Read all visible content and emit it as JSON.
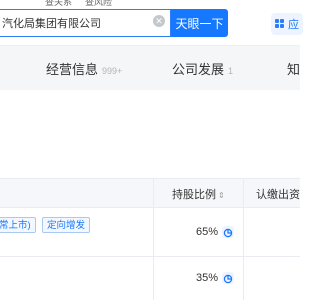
{
  "nav": {
    "links": [
      "查关系",
      "查风险"
    ]
  },
  "search": {
    "value": "汽化局集团有限公司",
    "button_label": "天眼一下"
  },
  "side_button": {
    "label": "应"
  },
  "tabs": [
    {
      "label": "经营信息",
      "count": "999+"
    },
    {
      "label": "公司发展",
      "count": "1"
    },
    {
      "label": "知"
    }
  ],
  "table": {
    "headers": [
      "持股比例",
      "认缴出资"
    ],
    "rows": [
      {
        "tags": [
          "常上市)",
          "定向增发"
        ],
        "ratio": "65%"
      },
      {
        "tags": [],
        "ratio": "35%"
      }
    ]
  },
  "colors": {
    "accent": "#1677ff",
    "tag_border": "#a9c8f5"
  }
}
